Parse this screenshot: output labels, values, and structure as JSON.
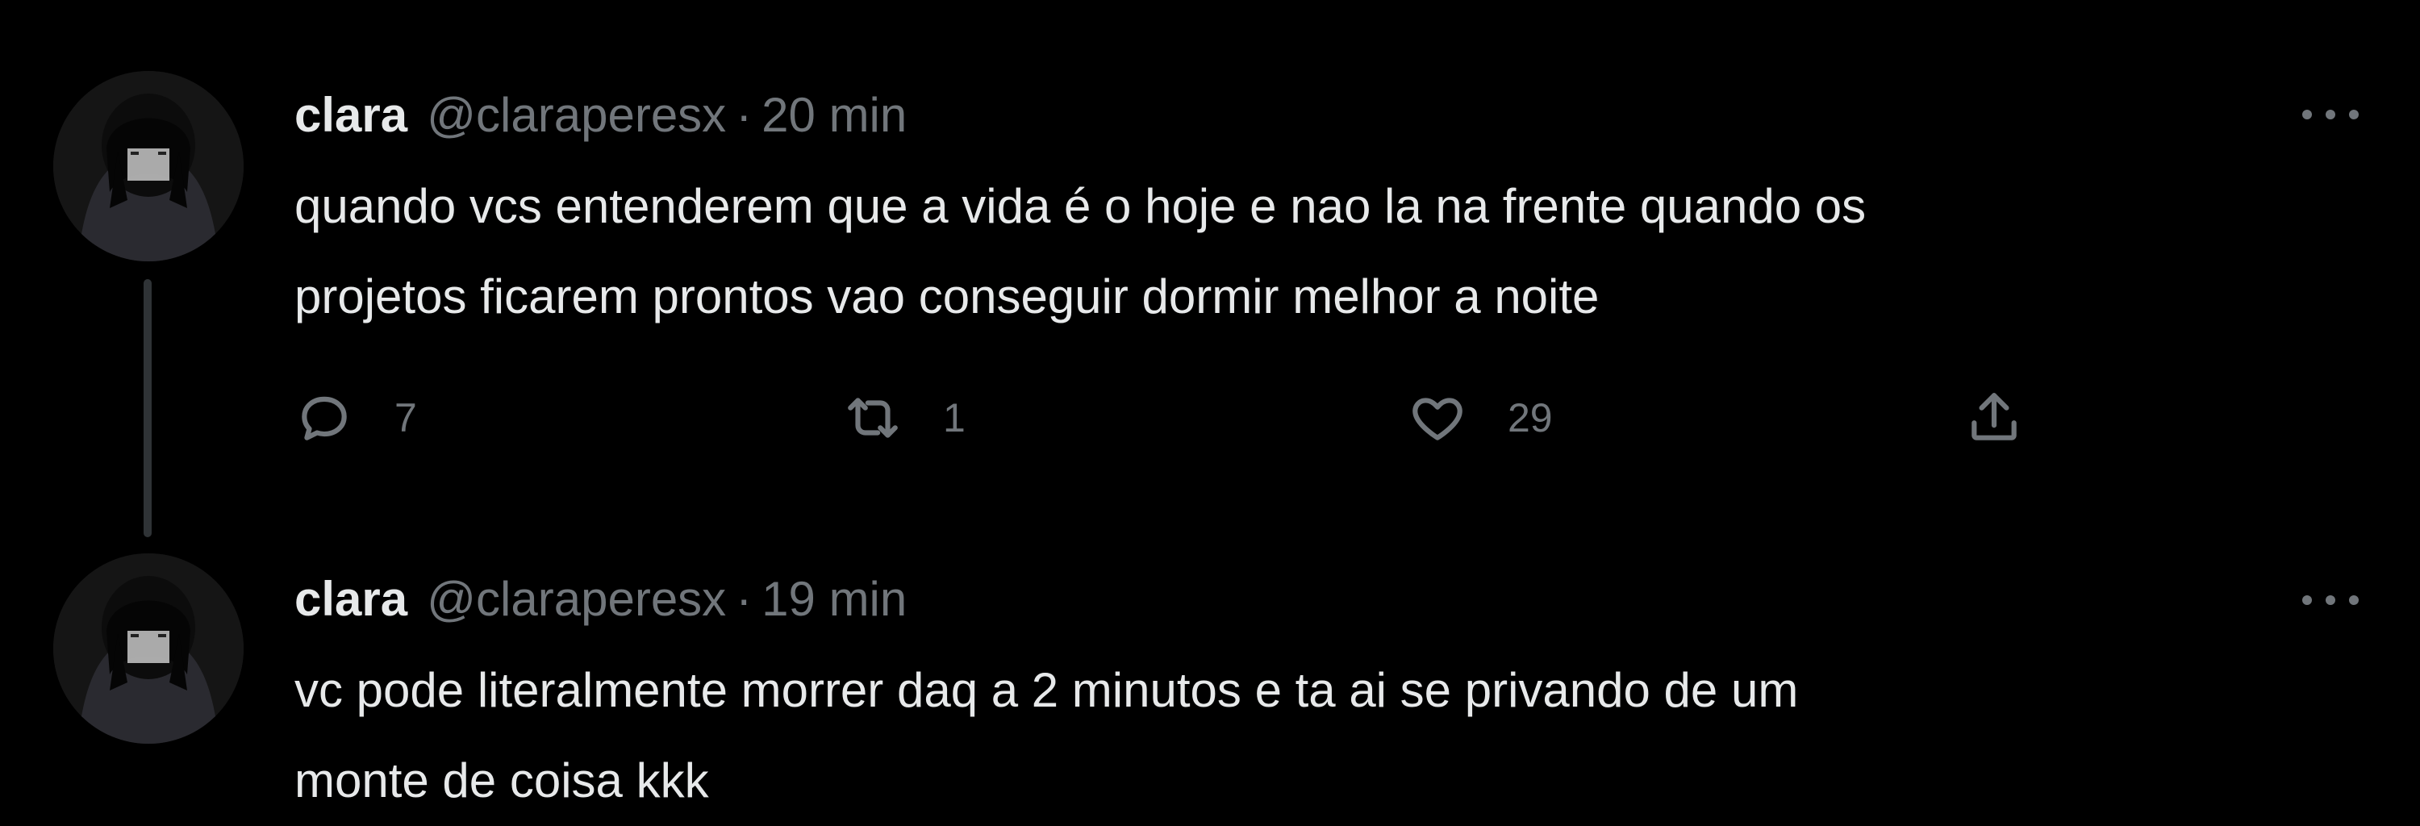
{
  "tweets": [
    {
      "author_name": "clara",
      "handle": "@claraperesx",
      "separator": "·",
      "time": "20 min",
      "text": "quando vcs entenderem que a vida é o hoje e nao la na frente quando os\nprojetos ficarem prontos vao conseguir dormir melhor a noite",
      "replies": "7",
      "retweets": "1",
      "likes": "29",
      "icons": {
        "reply": "reply-icon",
        "retweet": "retweet-icon",
        "like": "heart-icon",
        "share": "share-icon",
        "more": "more-options-icon"
      }
    },
    {
      "author_name": "clara",
      "handle": "@claraperesx",
      "separator": "·",
      "time": "19 min",
      "text": "vc pode literalmente morrer daq a 2 minutos e ta ai se privando de um\nmonte de coisa kkk",
      "icons": {
        "more": "more-options-icon"
      }
    }
  ],
  "colors": {
    "background": "#000000",
    "primary_text": "#e7e9ea",
    "secondary_text": "#71767b",
    "thread_line": "#2f3336"
  }
}
